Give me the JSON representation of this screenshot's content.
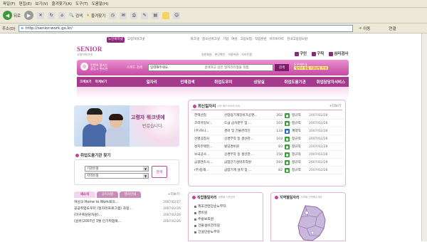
{
  "browser": {
    "menu": [
      "파일(F)",
      "편집(E)",
      "보기(V)",
      "즐겨찾기(A)",
      "도구(T)",
      "도움말(H)"
    ],
    "toolbar": {
      "back": "뒤로",
      "search": "검색",
      "favorites": "즐겨찾기"
    },
    "address_label": "주소(D)",
    "address_value": "http://senior.work.go.kr/",
    "go_label": "이동",
    "links_label": "연결"
  },
  "site": {
    "top_nav": [
      "노인복지넷",
      "고령자워크넷",
      "워크넷",
      "청소년워크넷",
      "기업",
      "여성",
      "고용보험",
      "직업훈련",
      "아르바이트",
      "한국고용정보원"
    ],
    "logo_text": "SENIOR",
    "logo_sub": "고령자워크넷",
    "small_links": [
      "일반회원",
      "본인확인",
      "이용약관",
      "사이트맵"
    ],
    "quick": [
      "구인",
      "구직",
      "심리검사"
    ],
    "pink_left_line1": "컨텐츠 즐기는",
    "pink_left_line2": "즐겁고 편리한",
    "search_label": "스피드 검색",
    "search_value": "입력해주세요.",
    "search_hint": "검색하고 싶은 일자리유형을 직접",
    "search_button": "검색",
    "pink_right_line1": "도우미안내",
    "pink_right_badge": "일자리 창출 이용방법 안내",
    "gnb_mini": [
      "크게보기",
      "작게보기"
    ],
    "gnb": [
      "일자리",
      "인재검색",
      "취업도우미",
      "상담실",
      "취업도움기관",
      "취업담당자서비스"
    ],
    "hero_title": "고령자 워크넷에",
    "hero_sub": "반갑습니다.",
    "agency": {
      "title": "취업도움기관 찾기",
      "select1": "기관유형",
      "select2": "지역유형",
      "button": "검색"
    },
    "news_tabs": [
      "새소식",
      "공지사항",
      "행사안내"
    ],
    "news_more": "+더보기",
    "news": [
      {
        "title": "여성의 Home to Work로의...",
        "date": "2007/02/27"
      },
      {
        "title": "공공취업도우미 (일자리프로그램) 과정...",
        "date": "2007/02/26"
      },
      {
        "title": "(미구축담당자원)...",
        "date": "2007/02/26"
      },
      {
        "title": "(원주)2007년 3월 단기취업복...",
        "date": "2007/02/26"
      }
    ],
    "jobs": {
      "title": "최신일자리",
      "title_en": "JOB INFORMATION",
      "more": "+더보기",
      "rows": [
        {
          "company": "한맥산업",
          "title": "산업용기계장비가공명...",
          "count": "202",
          "badge_color": "#3d9a3d",
          "type": "정규직",
          "date": "2007/02/28"
        },
        {
          "company": "코리아일보...",
          "title": "도급 금속분무 및 ...",
          "count": "103",
          "badge_color": "#3d9a3d",
          "type": "정규직",
          "date": "2007/02/28"
        },
        {
          "company": "(주)하나...",
          "title": "경비 및 건물관리인",
          "count": "133",
          "badge_color": "#2a6bb5",
          "type": "계약직",
          "date": "2007/02/28"
        },
        {
          "company": "선명공업사",
          "title": "상경부작 등 생산관...",
          "count": "103",
          "badge_color": "#3d9a3d",
          "type": "정규직",
          "date": "2007/02/28"
        },
        {
          "company": "성지주택현...",
          "title": "빌딩경비원",
          "count": "83",
          "badge_color": "#3d9a3d",
          "type": "정규직",
          "date": "2007/02/28"
        },
        {
          "company": "보국공사...",
          "title": "상경부작 등 생산관...",
          "count": "150",
          "badge_color": "#3d9a3d",
          "type": "정규직",
          "date": "2007/02/28"
        },
        {
          "company": "금광텐츠시...",
          "title": "금업단기설비조작원",
          "count": "193",
          "badge_color": "#3d9a3d",
          "type": "정규직",
          "date": "2007/02/28"
        },
        {
          "company": "(주)동해...",
          "title": "금업기계 설치 및 ...",
          "count": "82",
          "badge_color": "#3d9a3d",
          "type": "정규직",
          "date": "2007/02/28"
        }
      ]
    },
    "job_search": {
      "title": "직업별일자리",
      "sub": "업종별 기준검색",
      "items": [
        "제조관련단순노무자",
        "경비원",
        "주방보조원",
        "건물설비관리원",
        "건설단순노무자"
      ]
    },
    "map_search": {
      "title": "지역별일자리",
      "sub": "지역을 선택해주세요"
    }
  }
}
